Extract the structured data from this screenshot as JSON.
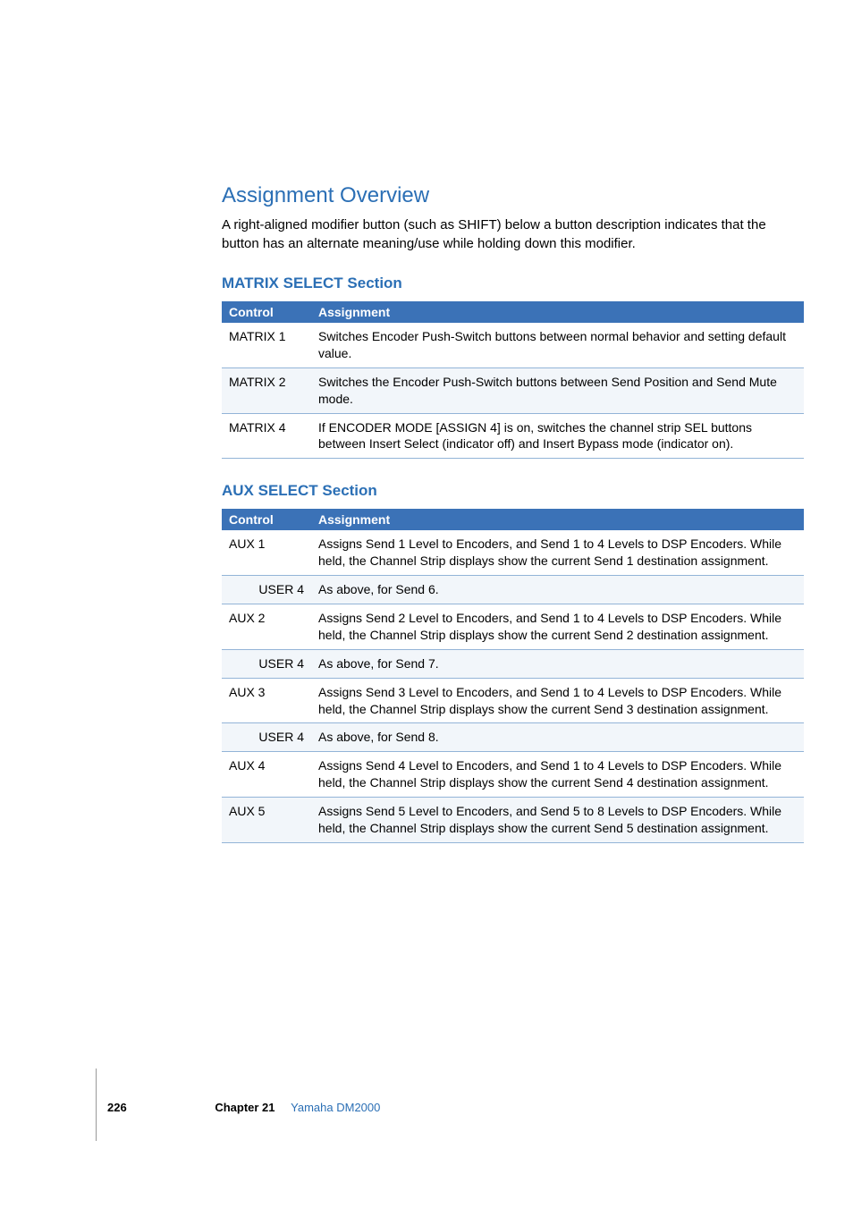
{
  "heading": "Assignment Overview",
  "intro": "A right-aligned modifier button (such as SHIFT) below a button description indicates that the button has an alternate meaning/use while holding down this modifier.",
  "sections": [
    {
      "title": "MATRIX SELECT Section",
      "headers": {
        "control": "Control",
        "assignment": "Assignment"
      },
      "rows": [
        {
          "control": "MATRIX 1",
          "modifier": "",
          "assignment": "Switches Encoder Push-Switch buttons between normal behavior and setting default value."
        },
        {
          "control": "MATRIX 2",
          "modifier": "",
          "assignment": "Switches the Encoder Push-Switch buttons between Send Position and Send Mute mode."
        },
        {
          "control": "MATRIX 4",
          "modifier": "",
          "assignment": "If ENCODER MODE [ASSIGN 4] is on, switches the channel strip SEL buttons between Insert Select (indicator off) and Insert Bypass mode (indicator on)."
        }
      ]
    },
    {
      "title": "AUX SELECT Section",
      "headers": {
        "control": "Control",
        "assignment": "Assignment"
      },
      "rows": [
        {
          "control": "AUX 1",
          "modifier": "",
          "assignment": "Assigns Send 1 Level to Encoders, and Send 1 to 4 Levels to DSP Encoders. While held, the Channel Strip displays show the current Send 1 destination assignment."
        },
        {
          "control": "",
          "modifier": "USER 4",
          "assignment": "As above, for Send 6."
        },
        {
          "control": "AUX 2",
          "modifier": "",
          "assignment": "Assigns Send 2 Level to Encoders, and Send 1 to 4 Levels to DSP Encoders. While held, the Channel Strip displays show the current Send 2 destination assignment."
        },
        {
          "control": "",
          "modifier": "USER 4",
          "assignment": "As above, for Send 7."
        },
        {
          "control": "AUX 3",
          "modifier": "",
          "assignment": "Assigns Send 3 Level to Encoders, and Send 1 to 4 Levels to DSP Encoders. While held, the Channel Strip displays show the current Send 3 destination assignment."
        },
        {
          "control": "",
          "modifier": "USER 4",
          "assignment": "As above, for Send 8."
        },
        {
          "control": "AUX 4",
          "modifier": "",
          "assignment": "Assigns Send 4 Level to Encoders, and Send 1 to 4 Levels to DSP Encoders. While held, the Channel Strip displays show the current Send 4 destination assignment."
        },
        {
          "control": "AUX 5",
          "modifier": "",
          "assignment": "Assigns Send 5 Level to Encoders, and Send 5 to 8 Levels to DSP Encoders. While held, the Channel Strip displays show the current Send 5 destination assignment."
        }
      ]
    }
  ],
  "footer": {
    "page": "226",
    "chapter_label": "Chapter 21",
    "chapter_name": "Yamaha DM2000"
  }
}
